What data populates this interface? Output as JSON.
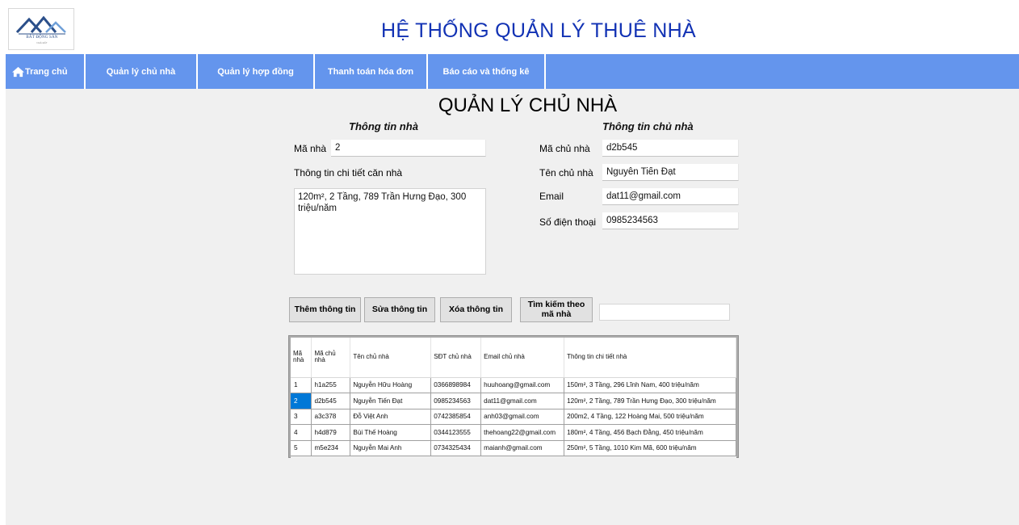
{
  "app": {
    "title": "HỆ THỐNG QUẢN LÝ THUÊ NHÀ",
    "logo_text": "BẤT ĐỘNG SẢN",
    "logo_subtext": "NHÀ ĐẤT"
  },
  "menu": {
    "items": [
      {
        "label": "Trang chủ",
        "icon": "home-icon"
      },
      {
        "label": "Quản lý chủ nhà"
      },
      {
        "label": "Quản lý hợp đồng"
      },
      {
        "label": "Thanh toán hóa đơn"
      },
      {
        "label": "Báo cáo và thống kê"
      }
    ]
  },
  "page": {
    "title": "QUẢN LÝ CHỦ NHÀ"
  },
  "house_info": {
    "section_title": "Thông tin nhà",
    "ma_nha_label": "Mã nhà",
    "ma_nha_value": "2",
    "detail_label": "Thông tin chi tiết căn nhà",
    "detail_value": "120m², 2 Tầng, 789 Trần Hưng Đạo, 300 triệu/năm"
  },
  "owner_info": {
    "section_title": "Thông tin chủ nhà",
    "ma_chu_nha_label": "Mã chủ nhà",
    "ma_chu_nha_value": "d2b545",
    "ten_chu_nha_label": "Tên chủ nhà",
    "ten_chu_nha_value": "Nguyễn Tiến Đạt",
    "email_label": "Email",
    "email_value": "dat11@gmail.com",
    "sdt_label": "Số điện thoại",
    "sdt_value": "0985234563"
  },
  "actions": {
    "add_label": "Thêm thông tin",
    "edit_label": "Sửa thông tin",
    "delete_label": "Xóa thông tin",
    "search_label_line1": "Tìm kiếm theo",
    "search_label_line2": "mã nhà",
    "search_value": ""
  },
  "table": {
    "headers": [
      "Mã nhà",
      "Mã chủ nhà",
      "Tên chủ nhà",
      "SĐT chủ nhà",
      "Email chủ nhà",
      "Thông tin chi tiết nhà"
    ],
    "selected_row": 1,
    "rows": [
      [
        "1",
        "h1a255",
        "Nguyễn Hữu Hoàng",
        "0366898984",
        "huuhoang@gmail.com",
        "150m², 3 Tầng, 296 Lĩnh Nam, 400 triệu/năm"
      ],
      [
        "2",
        "d2b545",
        "Nguyễn Tiến Đạt",
        "0985234563",
        "dat11@gmail.com",
        "120m², 2 Tầng, 789 Trần Hưng Đạo, 300 triệu/năm"
      ],
      [
        "3",
        "a3c378",
        "Đỗ Việt Anh",
        "0742385854",
        "anh03@gmail.com",
        "200m2, 4 Tầng, 122 Hoàng Mai, 500 triệu/năm"
      ],
      [
        "4",
        "h4d879",
        "Bùi Thế Hoàng",
        "0344123555",
        "thehoang22@gmail.com",
        "180m², 4 Tầng, 456 Bạch Đằng, 450 triệu/năm"
      ],
      [
        "5",
        "m5e234",
        "Nguyễn Mai Anh",
        "0734325434",
        "maianh@gmail.com",
        "250m², 5 Tầng, 1010 Kim Mã, 600 triệu/năm"
      ]
    ]
  }
}
